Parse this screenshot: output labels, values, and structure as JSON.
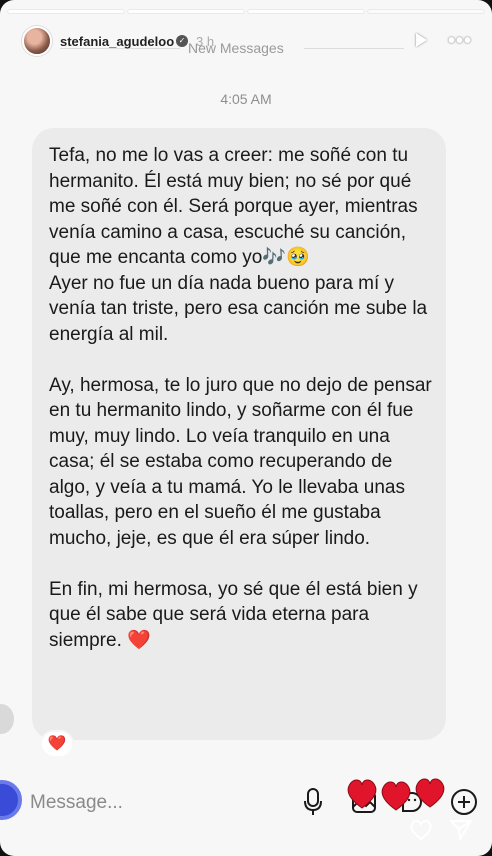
{
  "story": {
    "username": "stefania_agudeloo",
    "time_ago": "3 h",
    "progress_segments": 4,
    "progress_done": 3
  },
  "chat": {
    "divider_label": "New Messages",
    "timestamp": "4:05 AM",
    "message_paragraphs": [
      "Tefa, no me lo vas a creer: me soñé con tu hermanito. Él está muy bien; no sé por qué me soñé con él. Será porque ayer, mientras venía camino a casa, escuché su canción, que me encanta como yo🎶🥹\nAyer no fue un día nada bueno para mí y venía tan triste, pero esa canción me sube la energía al mil.",
      "Ay, hermosa, te lo juro que no dejo de pensar en tu hermanito lindo, y soñarme con él fue muy, muy lindo. Lo veía tranquilo en una casa; él se estaba como recuperando de algo, y veía a tu mamá. Yo le llevaba unas toallas, pero en el sueño él me gustaba mucho, jeje, es que él era súper lindo.",
      "En fin, mi hermosa, yo sé que él está bien y que él sabe que será vida eterna para siempre. ❤️"
    ],
    "reaction": "❤️"
  },
  "composer": {
    "placeholder": "Message..."
  },
  "icons": {
    "verified": "verified-badge-icon",
    "play": "play-icon",
    "more": "more-icon",
    "mic": "microphone-icon",
    "gallery": "gallery-icon",
    "sticker": "sticker-icon",
    "plus": "plus-icon",
    "like": "heart-outline-icon",
    "send": "send-icon"
  },
  "colors": {
    "bubble": "#ebebeb",
    "background": "#f7f7f7",
    "heart": "#e0152b",
    "text": "#1a1a1a"
  }
}
